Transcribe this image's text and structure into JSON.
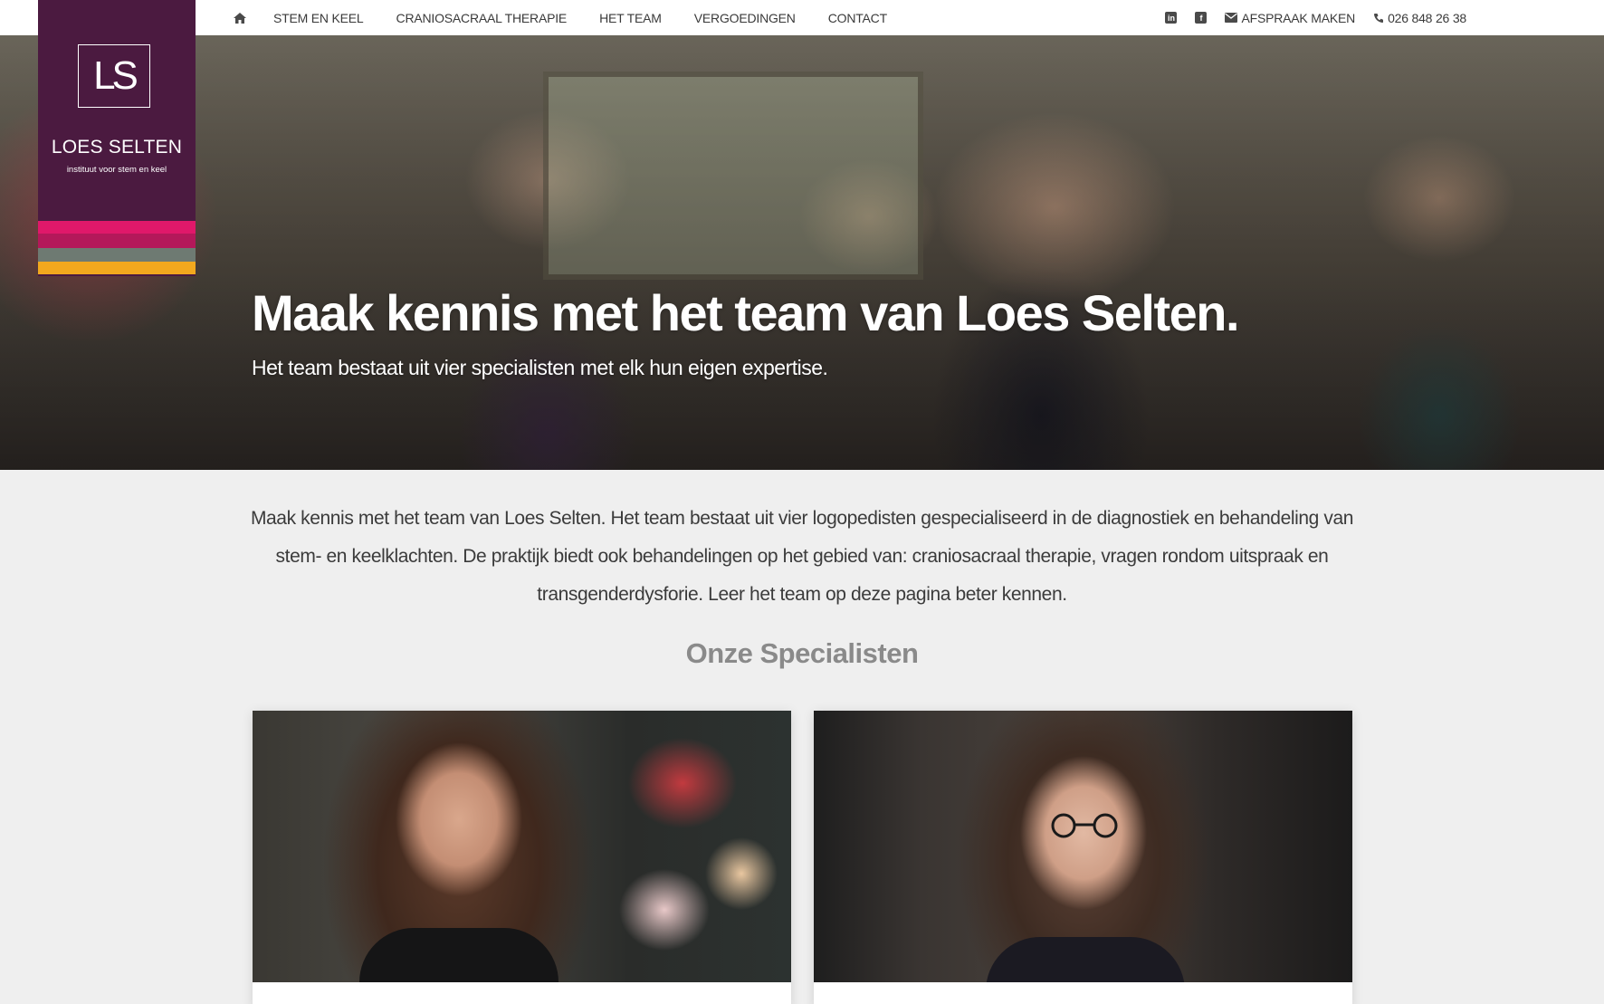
{
  "nav": {
    "items": [
      {
        "label": "STEM EN KEEL"
      },
      {
        "label": "CRANIOSACRAAL THERAPIE"
      },
      {
        "label": "HET TEAM"
      },
      {
        "label": "VERGOEDINGEN"
      },
      {
        "label": "CONTACT"
      }
    ],
    "appointment_label": "AFSPRAAK MAKEN",
    "phone_label": "026 848 26 38",
    "icons": [
      "home-icon",
      "linkedin-icon",
      "facebook-icon",
      "envelope-icon",
      "phone-icon"
    ]
  },
  "logo": {
    "monogram": "LS",
    "name": "LOES SELTEN",
    "tagline": "instituut voor stem en keel",
    "colors": [
      "#4b1a40",
      "#e0186a",
      "#b4185a",
      "#6e7a72",
      "#f2a81e"
    ]
  },
  "hero": {
    "title": "Maak kennis met het team van Loes Selten.",
    "subtitle": "Het team bestaat uit vier specialisten met elk hun eigen expertise."
  },
  "intro": {
    "text": "Maak kennis met het team van Loes Selten. Het team bestaat uit vier logopedisten gespecialiseerd in de diagnostiek en behandeling van stem- en keelklachten. De praktijk biedt ook behandelingen op het gebied van: craniosacraal therapie, vragen rondom uitspraak en transgenderdysforie. Leer het team op deze pagina beter kennen."
  },
  "specialists": {
    "title": "Onze Specialisten"
  }
}
